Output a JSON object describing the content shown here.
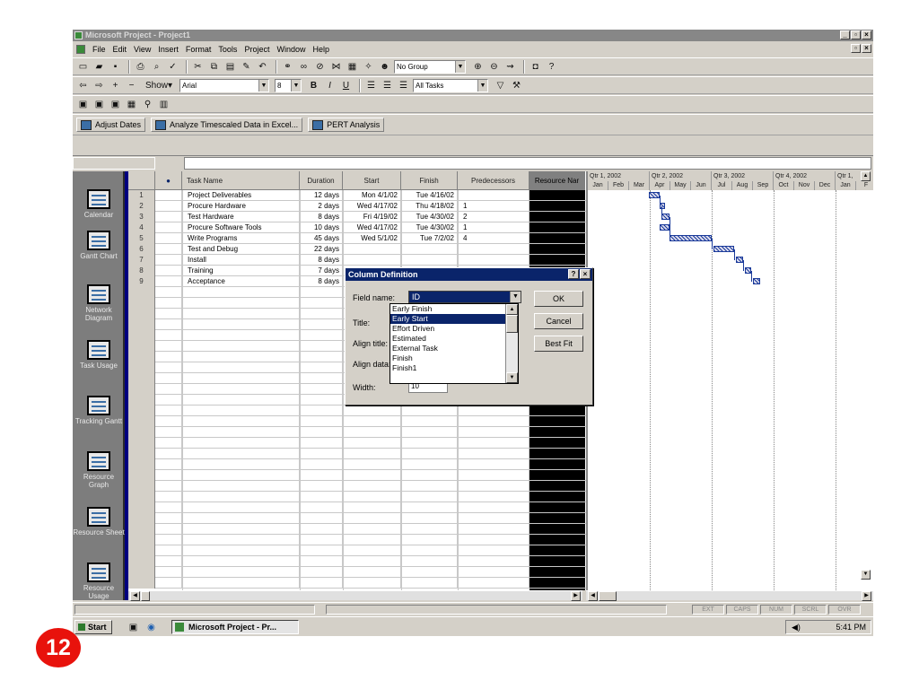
{
  "window": {
    "title": "Microsoft Project - Project1"
  },
  "menu": [
    "File",
    "Edit",
    "View",
    "Insert",
    "Format",
    "Tools",
    "Project",
    "Window",
    "Help"
  ],
  "toolbar": {
    "group_value": "No Group",
    "font_value": "Arial",
    "size_value": "8",
    "filter_value": "All Tasks",
    "show_label": "Show"
  },
  "analysis": {
    "adjust_dates": "Adjust Dates",
    "analyze": "Analyze Timescaled Data in Excel...",
    "pert": "PERT Analysis"
  },
  "view_bar": [
    {
      "label": "Calendar",
      "icon": "calendar-icon"
    },
    {
      "label": "Gantt Chart",
      "icon": "gantt-chart-icon"
    },
    {
      "label": "Network Diagram",
      "icon": "network-diagram-icon"
    },
    {
      "label": "Task Usage",
      "icon": "task-usage-icon"
    },
    {
      "label": "Tracking Gantt",
      "icon": "tracking-gantt-icon"
    },
    {
      "label": "Resource Graph",
      "icon": "resource-graph-icon"
    },
    {
      "label": "Resource Sheet",
      "icon": "resource-sheet-icon"
    },
    {
      "label": "Resource Usage",
      "icon": "resource-usage-icon"
    }
  ],
  "table": {
    "headers": [
      "Task Name",
      "Duration",
      "Start",
      "Finish",
      "Predecessors",
      "Resource Nar"
    ],
    "rows": [
      {
        "id": "1",
        "name": "Project Deliverables",
        "duration": "12 days",
        "start": "Mon 4/1/02",
        "finish": "Tue 4/16/02",
        "pred": ""
      },
      {
        "id": "2",
        "name": "Procure Hardware",
        "duration": "2 days",
        "start": "Wed 4/17/02",
        "finish": "Thu 4/18/02",
        "pred": "1"
      },
      {
        "id": "3",
        "name": "Test Hardware",
        "duration": "8 days",
        "start": "Fri 4/19/02",
        "finish": "Tue 4/30/02",
        "pred": "2"
      },
      {
        "id": "4",
        "name": "Procure Software Tools",
        "duration": "10 days",
        "start": "Wed 4/17/02",
        "finish": "Tue 4/30/02",
        "pred": "1"
      },
      {
        "id": "5",
        "name": "Write Programs",
        "duration": "45 days",
        "start": "Wed 5/1/02",
        "finish": "Tue 7/2/02",
        "pred": "4"
      },
      {
        "id": "6",
        "name": "Test and Debug",
        "duration": "22 days",
        "start": "",
        "finish": "",
        "pred": ""
      },
      {
        "id": "7",
        "name": "Install",
        "duration": "8 days",
        "start": "",
        "finish": "",
        "pred": ""
      },
      {
        "id": "8",
        "name": "Training",
        "duration": "7 days",
        "start": "",
        "finish": "",
        "pred": ""
      },
      {
        "id": "9",
        "name": "Acceptance",
        "duration": "8 days",
        "start": "",
        "finish": "",
        "pred": ""
      }
    ]
  },
  "timescale": {
    "quarters": [
      "Qtr 1, 2002",
      "Qtr 2, 2002",
      "Qtr 3, 2002",
      "Qtr 4, 2002",
      "Qtr 1,"
    ],
    "months": [
      "Jan",
      "Feb",
      "Mar",
      "Apr",
      "May",
      "Jun",
      "Jul",
      "Aug",
      "Sep",
      "Oct",
      "Nov",
      "Dec",
      "Jan",
      "F"
    ]
  },
  "dialog": {
    "title": "Column Definition",
    "field_name_label": "Field name:",
    "field_name_value": "ID",
    "title_label": "Title:",
    "align_title_label": "Align title:",
    "align_data_label": "Align data:",
    "width_label": "Width:",
    "width_value": "10",
    "ok": "OK",
    "cancel": "Cancel",
    "best_fit": "Best Fit",
    "options": [
      "Early Finish",
      "Early Start",
      "Effort Driven",
      "Estimated",
      "External Task",
      "Finish",
      "Finish1"
    ],
    "selected_option": "Early Start"
  },
  "status": {
    "panels": [
      "EXT",
      "CAPS",
      "NUM",
      "SCRL",
      "OVR"
    ]
  },
  "taskbar": {
    "start": "Start",
    "task": "Microsoft Project - Pr...",
    "time": "5:41 PM"
  },
  "slide_number": "12"
}
